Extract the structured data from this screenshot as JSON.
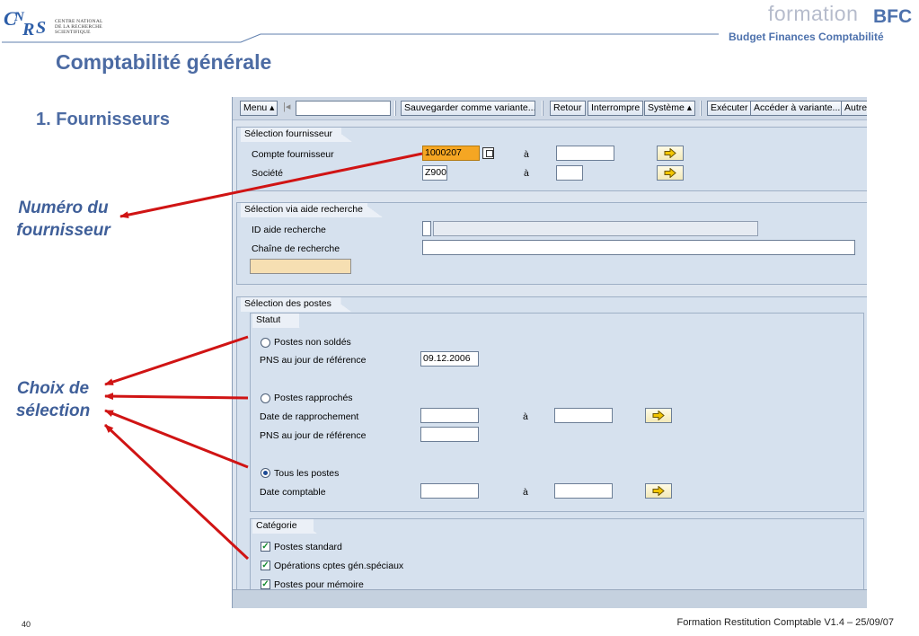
{
  "header": {
    "logo_lines": [
      "CENTRE NATIONAL",
      "DE LA RECHERCHE",
      "SCIENTIFIQUE"
    ],
    "brand_formation": "formation",
    "brand_bfc": "BFC",
    "brand_subtitle": "Budget Finances Comptabilité",
    "page_title": "Comptabilité générale",
    "section_title": "1. Fournisseurs"
  },
  "callouts": {
    "numero_fournisseur": "Numéro du fournisseur",
    "choix_selection": "Choix de sélection"
  },
  "sap": {
    "toolbar": {
      "menu": "Menu ▴",
      "command_field": "",
      "save_variant": "Sauvegarder comme variante...",
      "back": "Retour",
      "cancel": "Interrompre",
      "system": "Système ▴",
      "execute": "Exécuter",
      "goto_variant": "Accéder à variante...",
      "other": "Autres"
    },
    "supplier_selection": {
      "title": "Sélection fournisseur",
      "account_label": "Compte fournisseur",
      "account_value": "1000207",
      "account_to": "",
      "company_label": "Société",
      "company_value": "Z900",
      "company_to": "",
      "to_label": "à"
    },
    "search_help": {
      "title": "Sélection via aide recherche",
      "id_label": "ID aide recherche",
      "string_label": "Chaîne de recherche",
      "string_value": ""
    },
    "items": {
      "title": "Sélection des postes",
      "status": {
        "title": "Statut",
        "open_items": "Postes non soldés",
        "open_key_date_label": "PNS au jour de référence",
        "open_key_date": "09.12.2006",
        "cleared_items": "Postes rapprochés",
        "clearing_date_label": "Date de rapprochement",
        "cleared_key_date_label": "PNS au jour de référence",
        "all_items": "Tous les postes",
        "posting_date_label": "Date comptable",
        "to_label": "à",
        "selected": "all_items"
      },
      "category": {
        "title": "Catégorie",
        "standard": "Postes standard",
        "special_gl": "Opérations cptes gén.spéciaux",
        "memo": "Postes pour mémoire"
      }
    }
  },
  "footer": {
    "page_number": "40",
    "text": "Formation Restitution Comptable V1.4 – 25/09/07"
  },
  "colors": {
    "title_blue": "#4c6ba3",
    "arrow_red": "#d01414",
    "sap_background": "#dde5ef",
    "required_field": "#f5a623"
  }
}
